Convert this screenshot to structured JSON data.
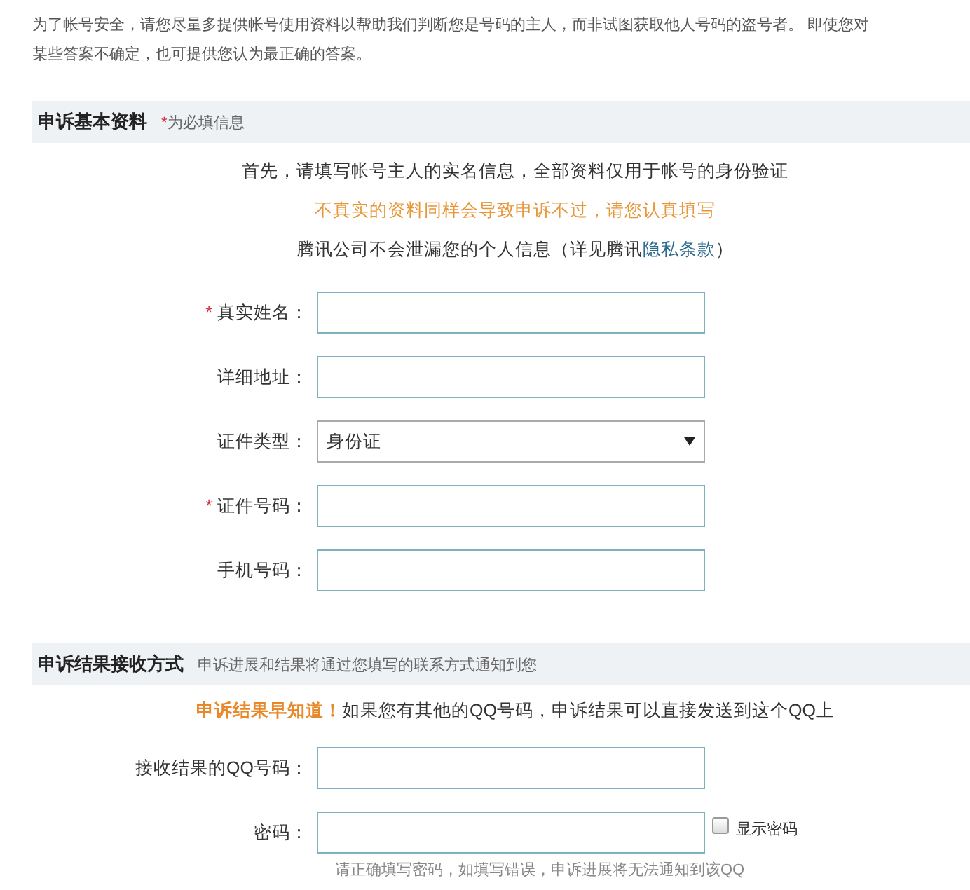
{
  "intro": "为了帐号安全，请您尽量多提供帐号使用资料以帮助我们判断您是号码的主人，而非试图获取他人号码的盗号者。 即使您对某些答案不确定，也可提供您认为最正确的答案。",
  "basic_section": {
    "title": "申诉基本资料",
    "required_mark": "*",
    "note": "为必填信息",
    "lines": [
      {
        "kind": "plain",
        "text": "首先，请填写帐号主人的实名信息，全部资料仅用于帐号的身份验证"
      },
      {
        "kind": "warning",
        "text": "不真实的资料同样会导致申诉不过，请您认真填写"
      },
      {
        "kind": "privacy",
        "text": "腾讯公司不会泄漏您的个人信息（详见腾讯",
        "link": "隐私条款",
        "tail": "）"
      }
    ],
    "fields": [
      {
        "kind": "input",
        "label": "真实姓名：",
        "required": true
      },
      {
        "kind": "input",
        "label": "详细地址：",
        "required": false
      },
      {
        "kind": "select",
        "label": "证件类型：",
        "required": false,
        "value": "身份证"
      },
      {
        "kind": "input",
        "label": "证件号码：",
        "required": true
      },
      {
        "kind": "input",
        "label": "手机号码：",
        "required": false
      }
    ]
  },
  "result_section": {
    "title": "申诉结果接收方式",
    "note": "申诉进展和结果将通过您填写的联系方式通知到您",
    "highlight": "申诉结果早知道！",
    "message": "如果您有其他的QQ号码，申诉结果可以直接发送到这个QQ上",
    "fields": [
      {
        "kind": "input",
        "label": "接收结果的QQ号码："
      },
      {
        "kind": "password",
        "label": "密码：",
        "show_label": "显示密码",
        "show_checked": false
      }
    ],
    "hint": "请正确填写密码，如填写错误，申诉进展将无法通知到该QQ"
  }
}
